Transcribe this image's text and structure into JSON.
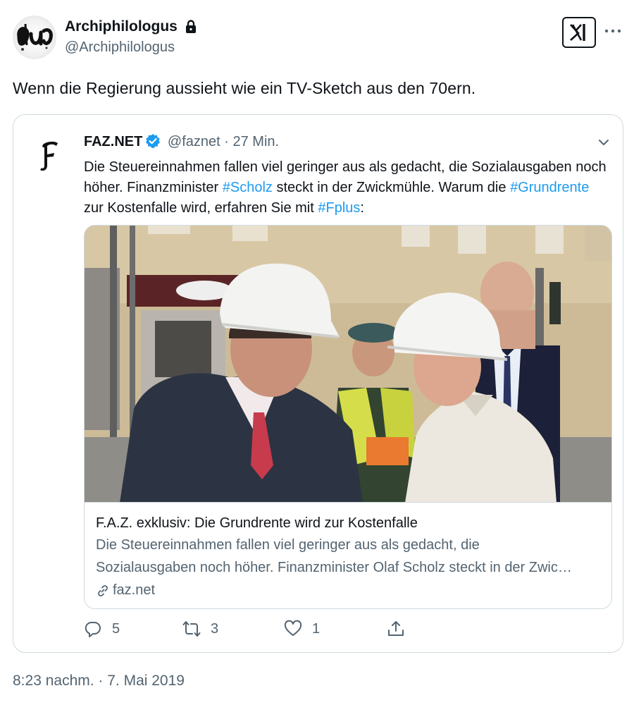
{
  "author": {
    "display_name": "Archiphilologus",
    "handle": "@Archiphilologus"
  },
  "tweet": {
    "text": "Wenn die Regierung aussieht wie ein TV-Sketch aus den 70ern.",
    "timestamp": "8:23 nachm. · 7. Mai 2019"
  },
  "quoted": {
    "display_name": "FAZ.NET",
    "handle": "@faznet",
    "separator": "·",
    "time": "27 Min.",
    "text_parts": {
      "p1": "Die Steuereinnahmen fallen viel geringer aus als gedacht, die Sozialausgaben noch höher. Finanzminister ",
      "tag1": "#Scholz",
      "p2": " steckt in der Zwickmühle. Warum die ",
      "tag2": "#Grundrente",
      "p3": " zur Kostenfalle wird, erfahren Sie mit ",
      "tag3": "#Fplus",
      "p4": ":"
    },
    "card": {
      "title": "F.A.Z. exklusiv: Die Grundrente wird zur Kostenfalle",
      "desc_line1": "Die Steuereinnahmen fallen viel geringer aus als gedacht, die",
      "desc_line2": "Sozialausgaben noch höher. Finanzminister Olaf Scholz steckt in der Zwic…",
      "domain": "faz.net"
    },
    "actions": {
      "replies": "5",
      "retweets": "3",
      "likes": "1"
    }
  },
  "colors": {
    "accent": "#1d9bf0",
    "secondary_text": "#536471",
    "border": "#cfd9de"
  },
  "icons": [
    "lock-icon",
    "x-logo-icon",
    "more-icon",
    "verified-icon",
    "chevron-down-icon",
    "link-icon",
    "reply-icon",
    "retweet-icon",
    "like-icon",
    "share-icon"
  ]
}
